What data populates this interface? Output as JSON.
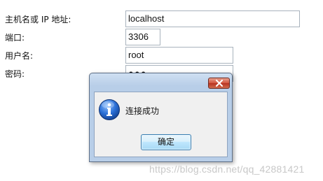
{
  "form": {
    "host_label": "主机名或 IP 地址:",
    "host_value": "localhost",
    "port_label": "端口:",
    "port_value": "3306",
    "user_label": "用户名:",
    "user_value": "root",
    "password_label": "密码:",
    "password_value": "●●●"
  },
  "dialog": {
    "message": "连接成功",
    "ok_label": "确定",
    "icon": "info-icon",
    "close_icon": "close-icon"
  },
  "watermark": {
    "text": "https://blog.csdn.net/qq_42881421"
  },
  "colors": {
    "dialog_frame": "#b8cee8",
    "close_button": "#c8462e",
    "info_icon": "#1f5fbf"
  }
}
